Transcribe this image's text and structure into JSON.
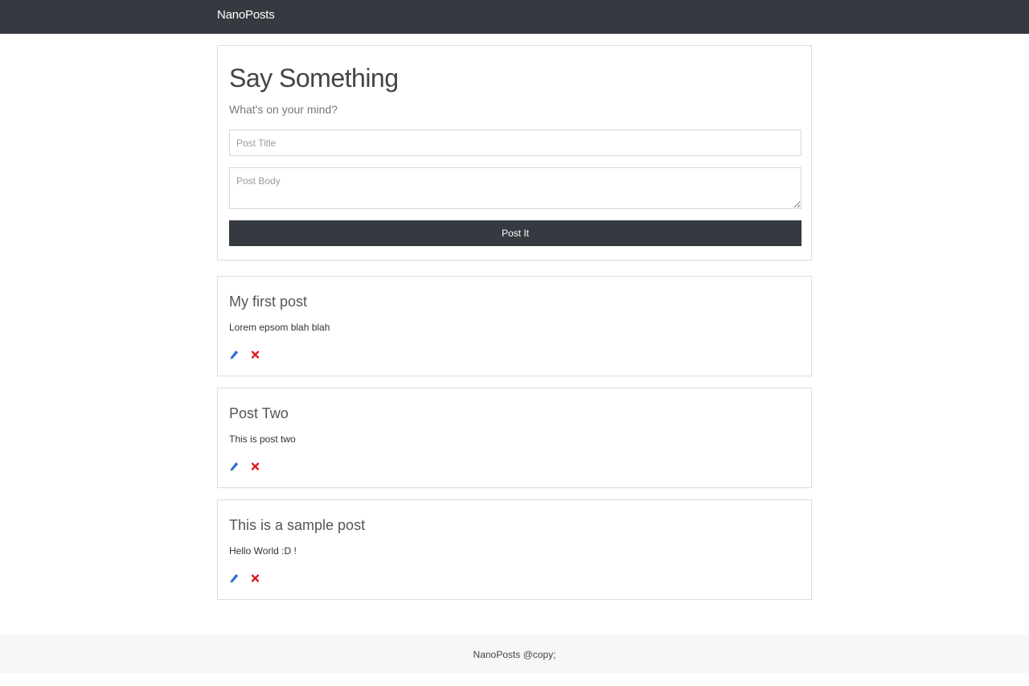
{
  "navbar": {
    "brand": "NanoPosts"
  },
  "compose": {
    "title": "Say Something",
    "subtitle": "What's on your mind?",
    "title_placeholder": "Post Title",
    "title_value": "",
    "body_placeholder": "Post Body",
    "body_value": "",
    "submit_label": "Post It"
  },
  "posts": [
    {
      "title": "My first post",
      "body": "Lorem epsom blah blah",
      "edit_icon": "pencil-icon",
      "delete_icon": "x-icon"
    },
    {
      "title": "Post Two",
      "body": "This is post two",
      "edit_icon": "pencil-icon",
      "delete_icon": "x-icon"
    },
    {
      "title": "This is a sample post",
      "body": "Hello World :D !",
      "edit_icon": "pencil-icon",
      "delete_icon": "x-icon"
    }
  ],
  "footer": {
    "text": "NanoPosts @copy;"
  },
  "colors": {
    "navbar": "#343a40",
    "button": "#343a40",
    "edit_icon": "#2f6fd6",
    "delete_icon": "#e0191c",
    "footer_bg": "#f7f7f8"
  }
}
